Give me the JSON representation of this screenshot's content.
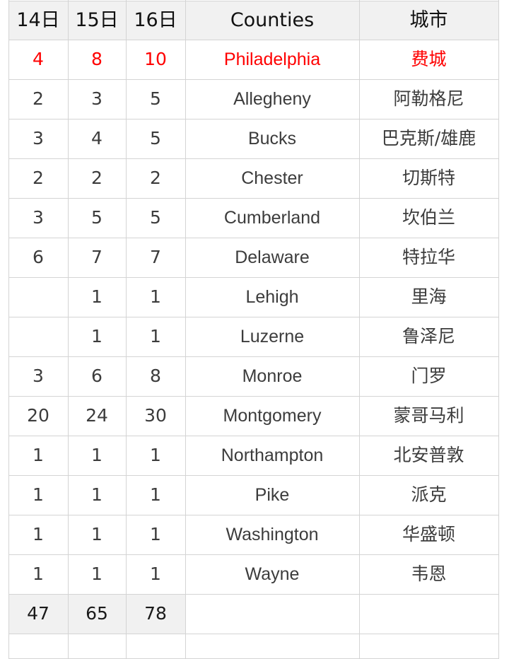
{
  "table": {
    "columns": [
      {
        "key": "d14",
        "label": "14日",
        "align": "center",
        "type": "number"
      },
      {
        "key": "d15",
        "label": "15日",
        "align": "center",
        "type": "number"
      },
      {
        "key": "d16",
        "label": "16日",
        "align": "center",
        "type": "number"
      },
      {
        "key": "county",
        "label": "Counties",
        "align": "center",
        "type": "text"
      },
      {
        "key": "city",
        "label": "城市",
        "align": "center",
        "type": "text"
      }
    ],
    "header": {
      "d14": "14日",
      "d15": "15日",
      "d16": "16日",
      "county": "Counties",
      "city": "城市"
    },
    "rows": [
      {
        "d14": "4",
        "d15": "8",
        "d16": "10",
        "county": "Philadelphia",
        "city": "费城",
        "highlight": true
      },
      {
        "d14": "2",
        "d15": "3",
        "d16": "5",
        "county": "Allegheny",
        "city": "阿勒格尼",
        "highlight": false
      },
      {
        "d14": "3",
        "d15": "4",
        "d16": "5",
        "county": "Bucks",
        "city": "巴克斯/雄鹿",
        "highlight": false
      },
      {
        "d14": "2",
        "d15": "2",
        "d16": "2",
        "county": "Chester",
        "city": "切斯特",
        "highlight": false
      },
      {
        "d14": "3",
        "d15": "5",
        "d16": "5",
        "county": "Cumberland",
        "city": "坎伯兰",
        "highlight": false
      },
      {
        "d14": "6",
        "d15": "7",
        "d16": "7",
        "county": "Delaware",
        "city": "特拉华",
        "highlight": false
      },
      {
        "d14": "",
        "d15": "1",
        "d16": "1",
        "county": "Lehigh",
        "city": "里海",
        "highlight": false
      },
      {
        "d14": "",
        "d15": "1",
        "d16": "1",
        "county": "Luzerne",
        "city": "鲁泽尼",
        "highlight": false
      },
      {
        "d14": "3",
        "d15": "6",
        "d16": "8",
        "county": "Monroe",
        "city": "门罗",
        "highlight": false
      },
      {
        "d14": "20",
        "d15": "24",
        "d16": "30",
        "county": "Montgomery",
        "city": "蒙哥马利",
        "highlight": false
      },
      {
        "d14": "1",
        "d15": "1",
        "d16": "1",
        "county": "Northampton",
        "city": "北安普敦",
        "highlight": false
      },
      {
        "d14": "1",
        "d15": "1",
        "d16": "1",
        "county": "Pike",
        "city": "派克",
        "highlight": false
      },
      {
        "d14": "1",
        "d15": "1",
        "d16": "1",
        "county": "Washington",
        "city": "华盛顿",
        "highlight": false
      },
      {
        "d14": "1",
        "d15": "1",
        "d16": "1",
        "county": "Wayne",
        "city": "韦恩",
        "highlight": false
      }
    ],
    "totals": {
      "d14": "47",
      "d15": "65",
      "d16": "78",
      "county": "",
      "city": ""
    }
  },
  "colors": {
    "highlight_text": "#ff0000",
    "header_background": "#f1f1f1",
    "totals_background": "#f1f1f1",
    "grid_line": "#d4d4d4",
    "body_text": "#3c3c3c",
    "county_text": "#404040"
  }
}
